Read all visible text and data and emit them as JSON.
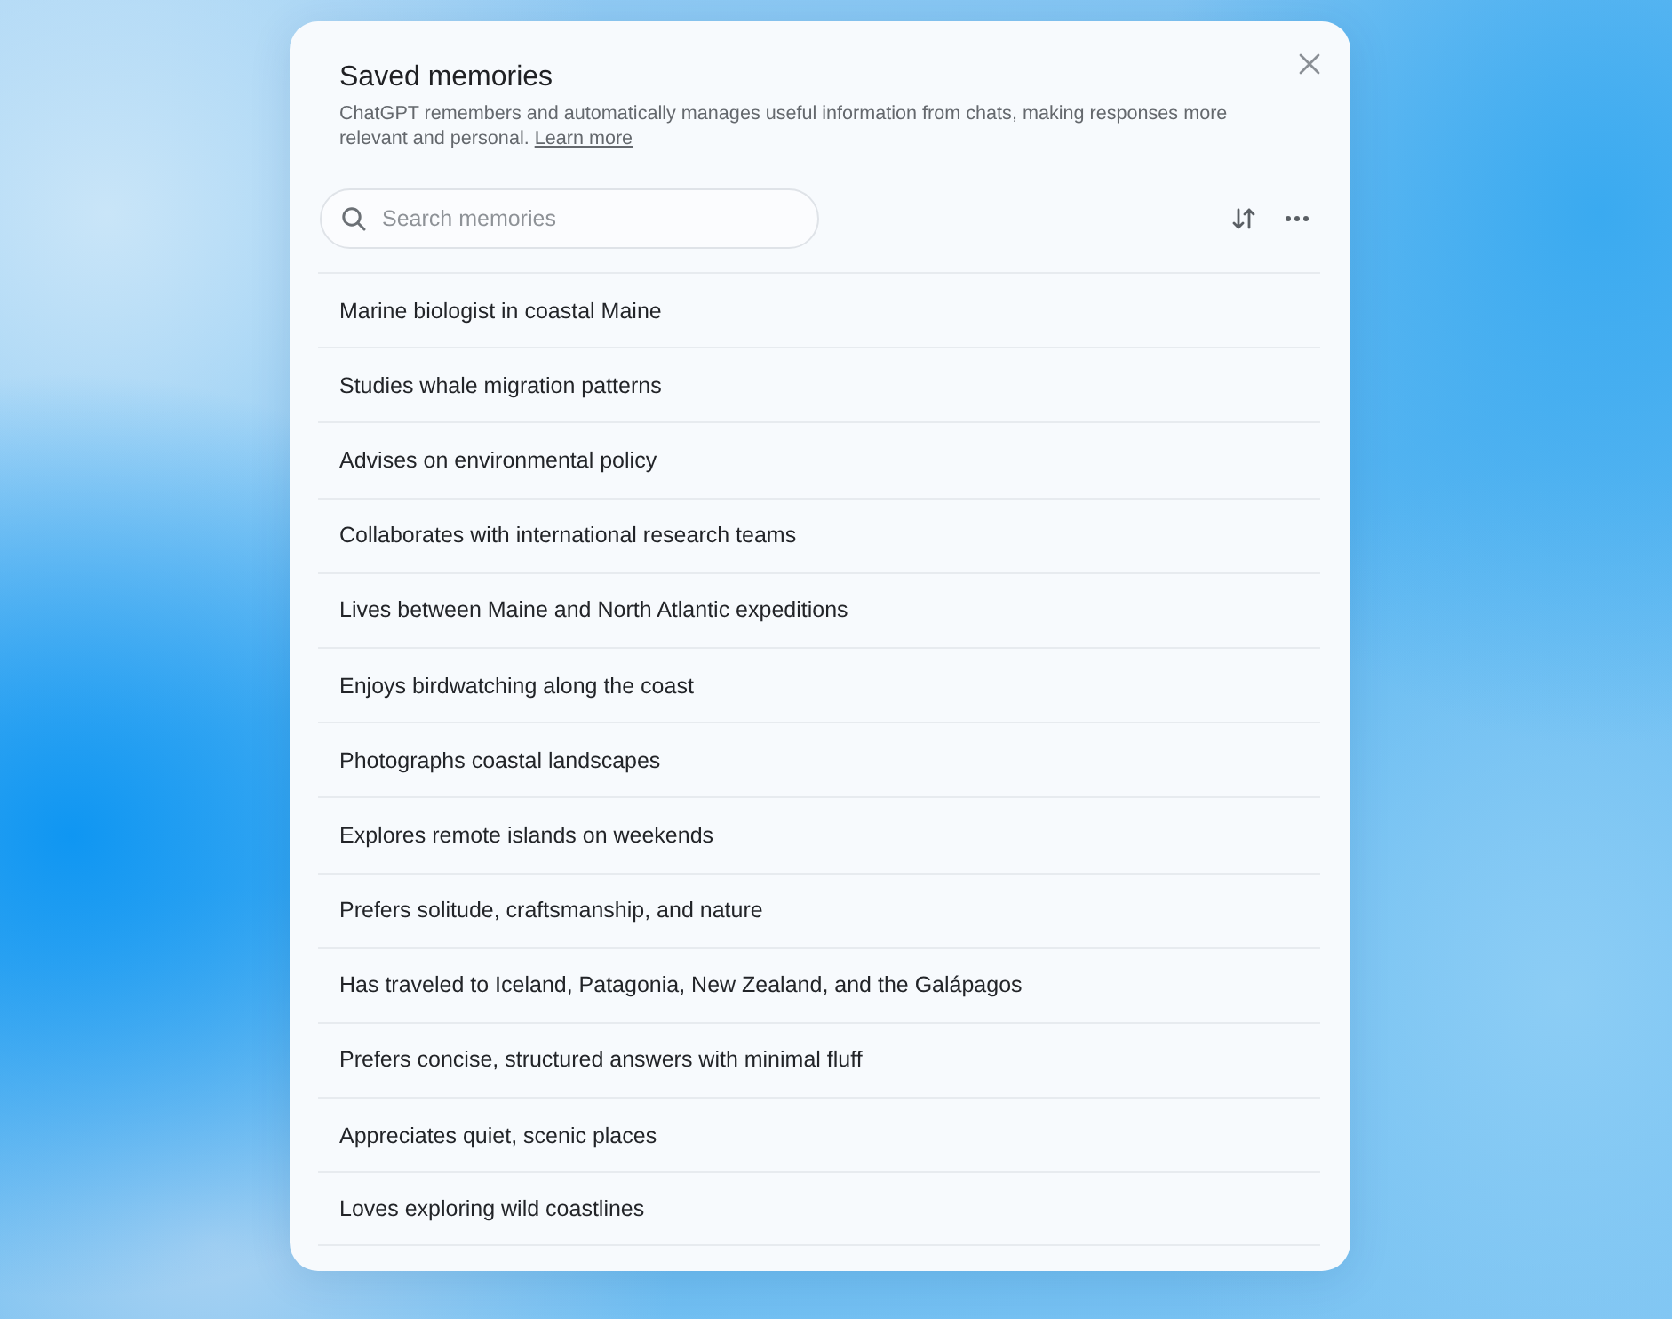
{
  "dialog": {
    "title": "Saved memories",
    "description": {
      "text": "ChatGPT remembers and automatically manages useful information from chats, making responses more relevant and personal.",
      "link": "Learn more"
    }
  },
  "search": {
    "placeholder": "Search memories"
  },
  "memories": [
    "Marine biologist in coastal Maine",
    "Studies whale migration patterns",
    "Advises on environmental policy",
    "Collaborates with international research teams",
    "Lives between Maine and North Atlantic expeditions",
    "Enjoys birdwatching along the coast",
    "Photographs coastal landscapes",
    "Explores remote islands on weekends",
    "Prefers solitude, craftsmanship, and nature",
    "Has traveled to Iceland, Patagonia, New Zealand, and the Galápagos",
    "Prefers concise, structured answers with minimal fluff",
    "Appreciates quiet, scenic places",
    "Loves exploring wild coastlines"
  ]
}
